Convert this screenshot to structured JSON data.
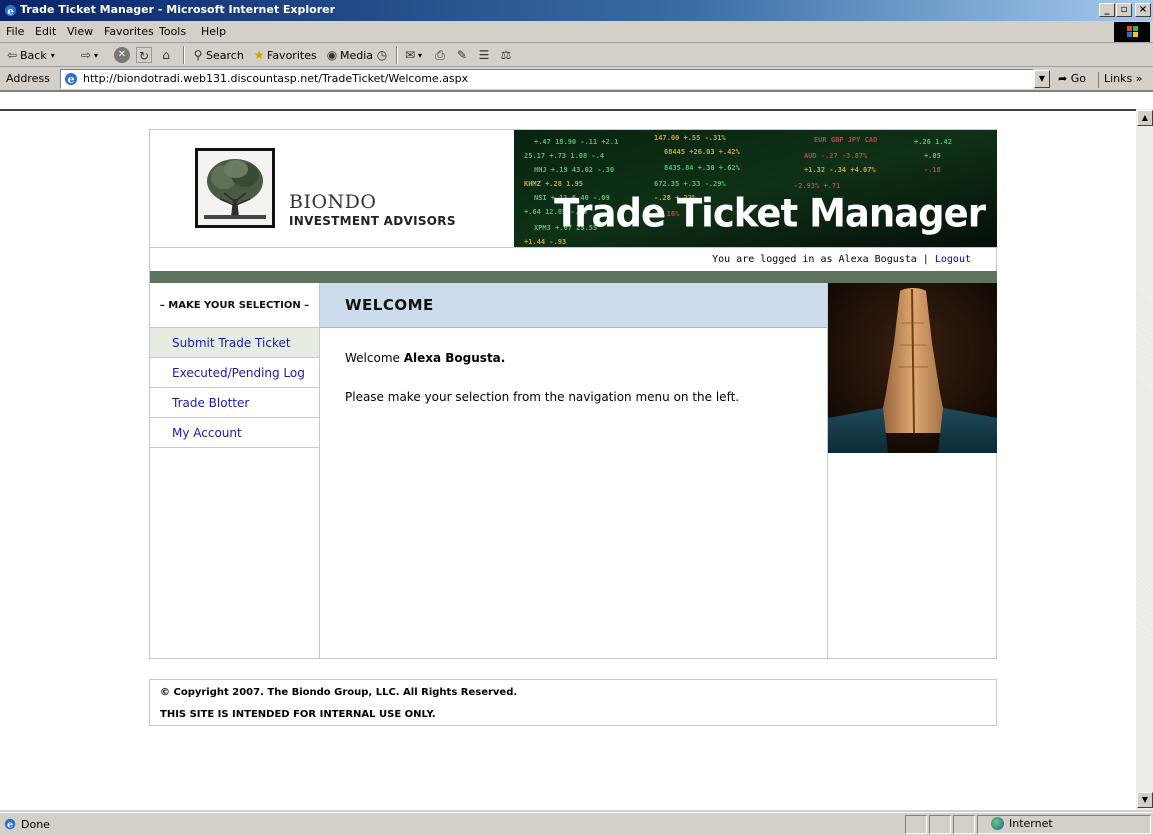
{
  "window": {
    "title": "Trade Ticket Manager - Microsoft Internet Explorer",
    "minimize": "_",
    "maximize": "▫",
    "close": "×"
  },
  "menu": [
    {
      "label": "File"
    },
    {
      "label": "Edit"
    },
    {
      "label": "View"
    },
    {
      "label": "Favorites"
    },
    {
      "label": "Tools"
    },
    {
      "label": "Help"
    }
  ],
  "toolbar": {
    "back": "Back",
    "search": "Search",
    "favorites": "Favorites",
    "media": "Media"
  },
  "address": {
    "label": "Address",
    "url": "http://biondotradi.web131.discountasp.net/TradeTicket/Welcome.aspx",
    "go": "Go",
    "links": "Links"
  },
  "header": {
    "brand_name": "BIONDO",
    "brand_sub": "INVESTMENT ADVISORS",
    "app_title": "Trade Ticket Manager",
    "logged_in_prefix": "You are logged in as Alexa Bogusta |",
    "logout": "Logout"
  },
  "sidebar": {
    "heading": "– MAKE YOUR SELECTION –",
    "items": [
      {
        "label": "Submit Trade Ticket",
        "active": true
      },
      {
        "label": "Executed/Pending Log",
        "active": false
      },
      {
        "label": "Trade Blotter",
        "active": false
      },
      {
        "label": "My Account",
        "active": false
      }
    ]
  },
  "main": {
    "heading": "WELCOME",
    "welcome_prefix": "Welcome",
    "user_name": "Alexa Bogusta.",
    "instructions": "Please make your selection from the navigation menu on the left."
  },
  "footer": {
    "copyright": "© Copyright 2007. The Biondo Group, LLC. All Rights Reserved.",
    "notice": "THIS SITE IS INTENDED FOR INTERNAL USE ONLY."
  },
  "status": {
    "text": "Done",
    "zone": "Internet"
  },
  "colors": {
    "nav_link": "#1a1ab0",
    "green_bar": "#5f7361",
    "welcome_header_bg": "#cddcec",
    "active_nav_bg": "#e5ede2"
  }
}
